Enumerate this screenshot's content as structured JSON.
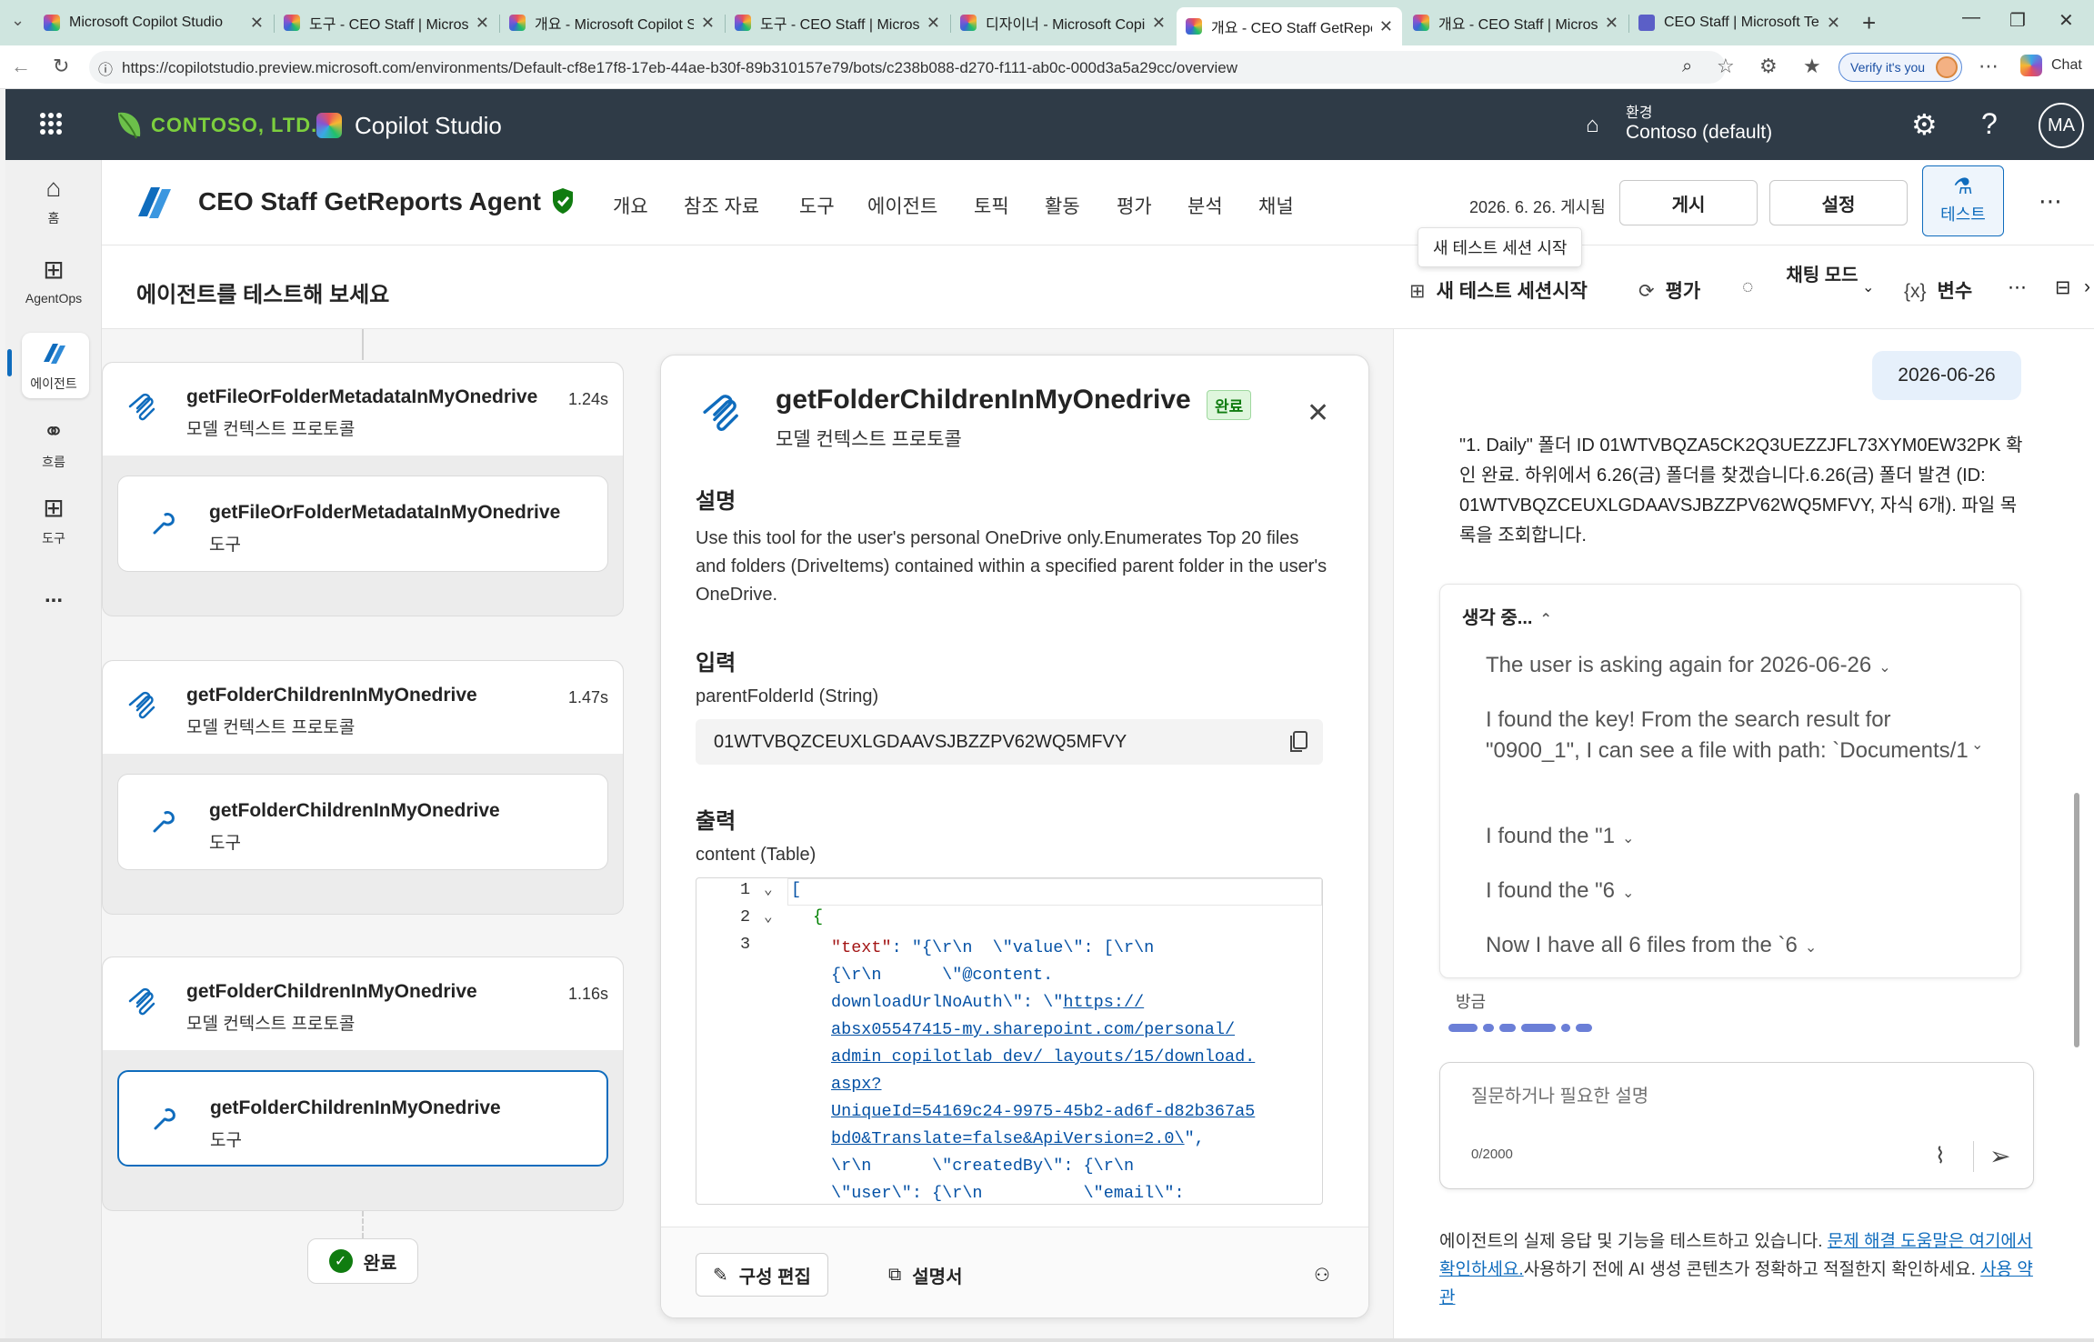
{
  "browser": {
    "tabs": [
      {
        "title": "Microsoft Copilot Studio",
        "icon": "copilot-studio-icon"
      },
      {
        "title": "도구 - CEO Staff | Microsof",
        "icon": "copilot-studio-icon"
      },
      {
        "title": "개요 - Microsoft Copilot St",
        "icon": "copilot-studio-icon"
      },
      {
        "title": "도구 - CEO Staff | Microsof",
        "icon": "copilot-studio-icon"
      },
      {
        "title": "디자이너 - Microsoft Copil",
        "icon": "copilot-studio-icon"
      },
      {
        "title": "개요 - CEO Staff GetReport",
        "icon": "copilot-studio-icon",
        "active": true
      },
      {
        "title": "개요 - CEO Staff | Microsof",
        "icon": "copilot-studio-icon"
      },
      {
        "title": "CEO Staff | Microsoft Team",
        "icon": "teams-icon"
      }
    ],
    "url": "https://copilotstudio.preview.microsoft.com/environments/Default-cf8e17f8-17eb-44ae-b30f-89b310157e79/bots/c238b088-d270-f111-ab0c-000d3a5a29cc/overview",
    "verify_label": "Verify it's you",
    "chat_label": "Chat"
  },
  "app": {
    "org_name": "CONTOSO, LTD.",
    "product": "Copilot Studio",
    "env_label": "환경",
    "env_value": "Contoso (default)",
    "avatar_initials": "MA"
  },
  "rail": [
    {
      "label": "홈",
      "icon": "home-icon"
    },
    {
      "label": "AgentOps",
      "icon": "agentops-icon"
    },
    {
      "label": "에이전트",
      "icon": "agent-icon",
      "active": true
    },
    {
      "label": "흐름",
      "icon": "flow-icon"
    },
    {
      "label": "도구",
      "icon": "tools-icon"
    },
    {
      "label": "...",
      "icon": "more-icon"
    }
  ],
  "agent": {
    "name": "CEO Staff GetReports Agent",
    "tabs": [
      "개요",
      "참조 자료",
      "도구",
      "에이전트",
      "토픽",
      "활동",
      "평가",
      "분석",
      "채널"
    ],
    "published": "2026. 6. 26. 게시됨",
    "publish_btn": "게시",
    "settings_btn": "설정",
    "test_btn": "테스트"
  },
  "test_header": {
    "title": "에이전트를 테스트해 보세요",
    "tooltip": "새 테스트 세션 시작",
    "new_session": "새 테스트 세션시작",
    "evaluate": "평가",
    "chat_mode": "채팅 모드",
    "variables": "변수"
  },
  "nodes": [
    {
      "title": "getFileOrFolderMetadataInMyOnedrive",
      "subtitle": "모델 컨텍스트 프로토콜",
      "duration": "1.24s",
      "tool_title": "getFileOrFolderMetadataInMyOnedrive",
      "tool_subtitle": "도구"
    },
    {
      "title": "getFolderChildrenInMyOnedrive",
      "subtitle": "모델 컨텍스트 프로토콜",
      "duration": "1.47s",
      "tool_title": "getFolderChildrenInMyOnedrive",
      "tool_subtitle": "도구"
    },
    {
      "title": "getFolderChildrenInMyOnedrive",
      "subtitle": "모델 컨텍스트 프로토콜",
      "duration": "1.16s",
      "tool_title": "getFolderChildrenInMyOnedrive",
      "tool_subtitle": "도구"
    }
  ],
  "done_label": "완료",
  "detail": {
    "title": "getFolderChildrenInMyOnedrive",
    "badge": "완료",
    "subtitle": "모델 컨텍스트 프로토콜",
    "desc_heading": "설명",
    "description": "Use this tool for the user's personal OneDrive only.Enumerates Top 20 files and folders (DriveItems) contained within a specified parent folder in the user's OneDrive.",
    "input_heading": "입력",
    "input_label": "parentFolderId (String)",
    "input_value": "01WTVBQZCEUXLGDAAVSJBZZPV62WQ5MFVY",
    "output_heading": "출력",
    "output_label": "content (Table)",
    "code_line_numbers": [
      "1",
      "2",
      "3"
    ],
    "code_open": "[",
    "code_obj_open": "{",
    "code_key": "\"text\"",
    "code_l1": ": \"{\\r\\n  \\\"value\\\": [\\r\\n",
    "code_l2": "{\\r\\n      \\\"@content.",
    "code_l3": "downloadUrlNoAuth\\\": \\\"",
    "code_link": [
      "https://",
      "absx05547415-my.sharepoint.com/personal/",
      "admin_copilotlab_dev/_layouts/15/download.",
      "aspx?",
      "UniqueId=54169c24-9975-45b2-ad6f-d82b367a5",
      "bd0&Translate=false&ApiVersion=2.0\\"
    ],
    "code_l4": "\",",
    "code_l5": "\\r\\n      \\\"createdBy\\\": {\\r\\n",
    "code_l6": "\\\"user\\\": {\\r\\n          \\\"email\\\":",
    "edit_btn": "구성 편집",
    "docs_btn": "설명서"
  },
  "chat": {
    "date_bubble": "2026-06-26",
    "bot_message": "\"1. Daily\" 폴더 ID 01WTVBQZA5CK2Q3UEZZJFL73XYM0EW32PK 확인 완료. 하위에서 6.26(금) 폴더를 찾겠습니다.6.26(금) 폴더 발견 (ID: 01WTVBQZCEUXLGDAAVSJBZZPV62WQ5MFVY, 자식 6개). 파일 목록을 조회합니다.",
    "thinking_title": "생각 중...",
    "thoughts": [
      "The user is asking again for 2026-06-26",
      "I found the key! From the search result for \"0900_1\", I can see a file with path: `Documents/1",
      "I found the \"1",
      "I found the \"6",
      "Now I have all 6 files from the `6"
    ],
    "just_now": "방금",
    "composer_placeholder": "질문하거나 필요한 설명",
    "char_count": "0/2000",
    "disclaimer_1": "에이전트의 실제 응답 및 기능을 테스트하고 있습니다. ",
    "disclaimer_link1": "문제 해결 도움말은 여기에서 확인하세요.",
    "disclaimer_2": "사용하기 전에 AI 생성 콘텐츠가 정확하고 적절한지 확인하세요. ",
    "disclaimer_link2": "사용 약관"
  },
  "colors": {
    "app_header": "#2f3b47",
    "accent": "#0f6cbd",
    "success": "#107c10",
    "tab_strip": "#cfe5df"
  }
}
